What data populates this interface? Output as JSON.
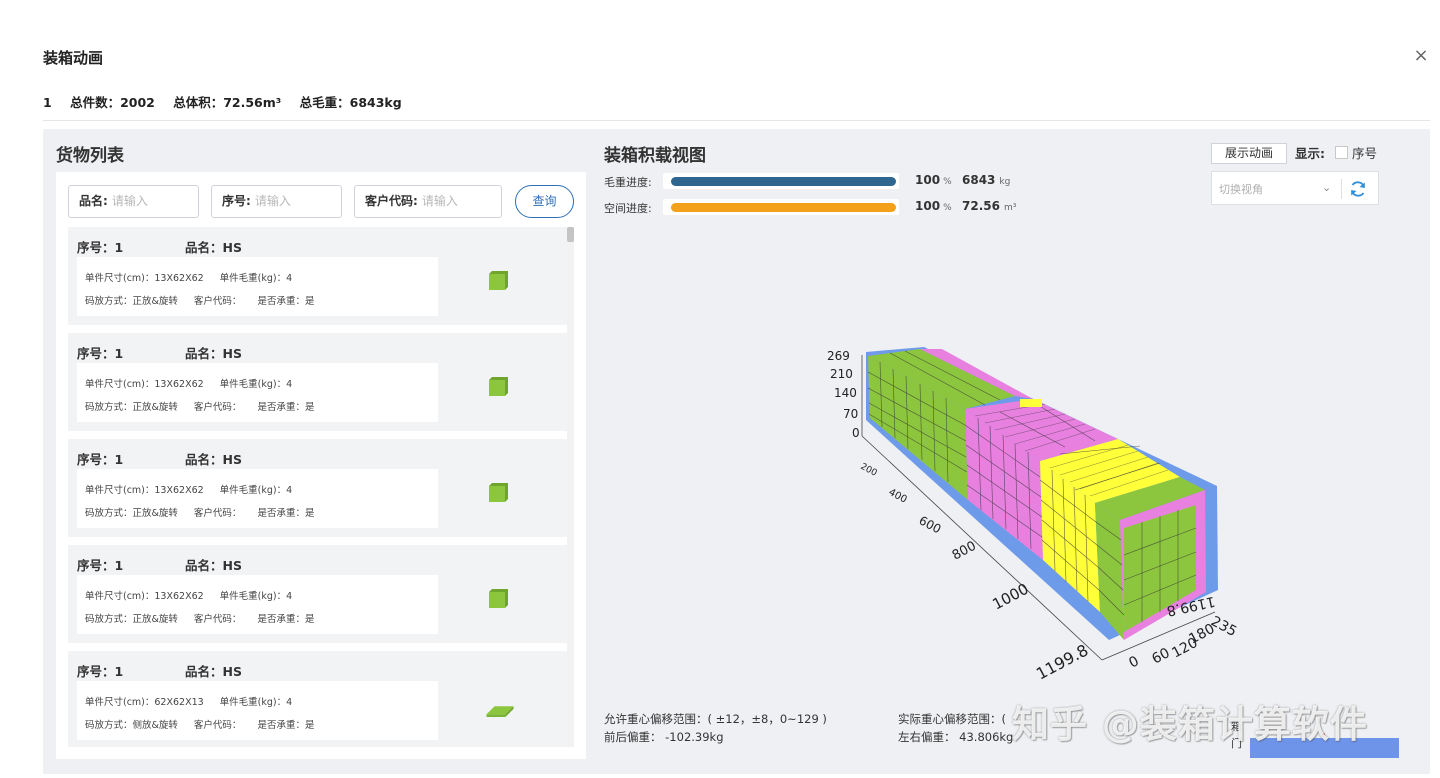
{
  "dialog": {
    "title": "装箱动画",
    "close_icon": "×",
    "summary": {
      "index": "1",
      "total_pieces": "总件数：2002",
      "total_volume": "总体积：72.56m³",
      "total_weight": "总毛重：6843kg"
    }
  },
  "goods": {
    "title": "货物列表",
    "filters": [
      {
        "label": "品名:",
        "placeholder": "请输入"
      },
      {
        "label": "序号:",
        "placeholder": "请输入"
      },
      {
        "label": "客户代码:",
        "placeholder": "请输入"
      }
    ],
    "query_label": "查询",
    "items": [
      {
        "seq": "序号：1",
        "name": "品名：HS",
        "size": "单件尺寸(cm)：13X62X62",
        "weight": "单件毛重(kg)：4",
        "placement": "码放方式：正放&旋转",
        "customer": "客户代码：",
        "bearing": "是否承重：是",
        "shape": "cube"
      },
      {
        "seq": "序号：1",
        "name": "品名：HS",
        "size": "单件尺寸(cm)：13X62X62",
        "weight": "单件毛重(kg)：4",
        "placement": "码放方式：正放&旋转",
        "customer": "客户代码：",
        "bearing": "是否承重：是",
        "shape": "cube"
      },
      {
        "seq": "序号：1",
        "name": "品名：HS",
        "size": "单件尺寸(cm)：13X62X62",
        "weight": "单件毛重(kg)：4",
        "placement": "码放方式：正放&旋转",
        "customer": "客户代码：",
        "bearing": "是否承重：是",
        "shape": "cube"
      },
      {
        "seq": "序号：1",
        "name": "品名：HS",
        "size": "单件尺寸(cm)：13X62X62",
        "weight": "单件毛重(kg)：4",
        "placement": "码放方式：正放&旋转",
        "customer": "客户代码：",
        "bearing": "是否承重：是",
        "shape": "cube"
      },
      {
        "seq": "序号：1",
        "name": "品名：HS",
        "size": "单件尺寸(cm)：62X62X13",
        "weight": "单件毛重(kg)：4",
        "placement": "码放方式：侧放&旋转",
        "customer": "客户代码：",
        "bearing": "是否承重：是",
        "shape": "flat"
      }
    ],
    "box_color": "#8cc63e"
  },
  "loading": {
    "title": "装箱积载视图",
    "weight_progress": {
      "label": "毛重进度:",
      "percent": "100",
      "percent_unit": "%",
      "value": "6843",
      "unit": "kg",
      "color": "#2f6690",
      "fraction": 1.0
    },
    "space_progress": {
      "label": "空间进度:",
      "percent": "100",
      "percent_unit": "%",
      "value": "72.56",
      "unit": "m³",
      "color": "#f3a11a",
      "fraction": 1.0
    },
    "animate_button": "展示动画",
    "show_label": "显示:",
    "seq_checkbox_label": "序号",
    "view_select_placeholder": "切换视角",
    "axes": {
      "height_ticks": [
        "269",
        "210",
        "140",
        "70",
        "0"
      ],
      "length_ticks": [
        "200",
        "400",
        "600",
        "800",
        "1000",
        "1199.8"
      ],
      "width_ticks": [
        "0",
        "60",
        "120",
        "180",
        "235"
      ],
      "end_label": "1199.8"
    },
    "cargo_colors": {
      "green": "#8cc63e",
      "pink": "#e880e0",
      "yellow": "#ffff3a",
      "container": "#6d9bea"
    },
    "footer": {
      "allowed_offset": "允许重心偏移范围：( ±12，±8，0~129 )",
      "front_back": "前后偏重： -102.39kg",
      "actual_offset": "实际重心偏移范围：(",
      "left_right": "左右偏重： 43.806kg",
      "door_label": "箱门"
    }
  },
  "watermark": "知乎 @装箱计算软件"
}
